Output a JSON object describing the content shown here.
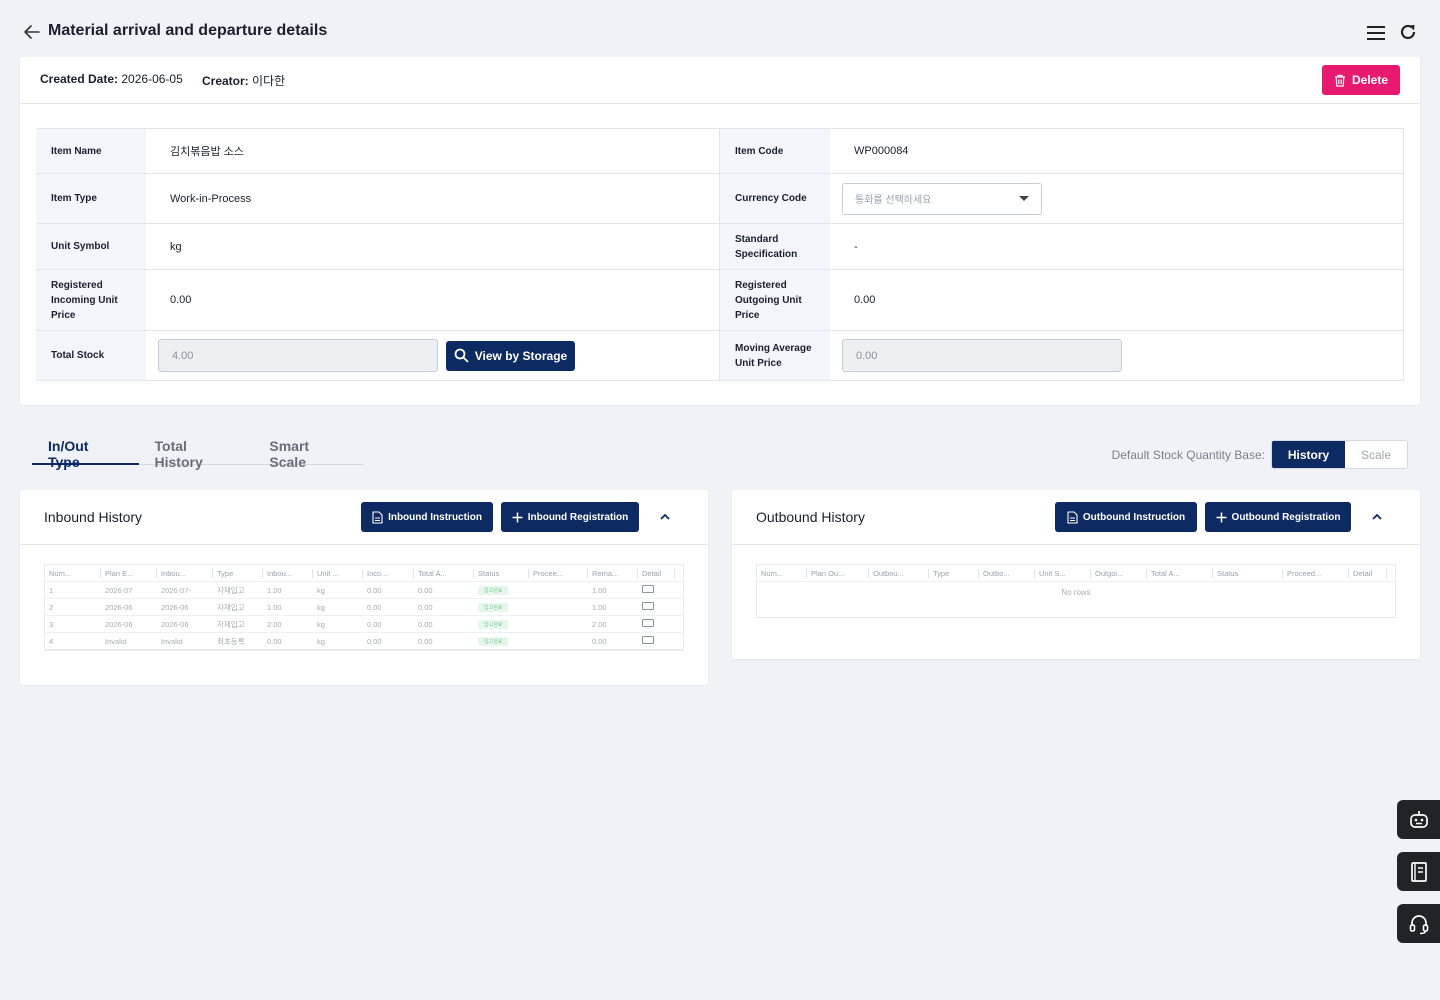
{
  "header": {
    "title": "Material arrival and departure details"
  },
  "meta": {
    "created_label": "Created Date:",
    "created_value": "2026-06-05",
    "creator_label": "Creator:",
    "creator_value": "이다한",
    "delete_label": "Delete"
  },
  "fields": {
    "item_name_label": "Item Name",
    "item_name": "김치볶음밥 소스",
    "item_code_label": "Item Code",
    "item_code": "WP000084",
    "item_type_label": "Item Type",
    "item_type": "Work-in-Process",
    "currency_label": "Currency Code",
    "currency_placeholder": "통화를 선택하세요",
    "unit_label": "Unit Symbol",
    "unit": "kg",
    "standard_label": "Standard Specification",
    "standard": "-",
    "in_price_label": "Registered Incoming Unit Price",
    "in_price": "0.00",
    "out_price_label": "Registered Outgoing Unit Price",
    "out_price": "0.00",
    "total_stock_label": "Total Stock",
    "total_stock": "4.00",
    "view_storage_label": "View by Storage",
    "moving_avg_label": "Moving Average Unit Price",
    "moving_avg": "0.00"
  },
  "tabs": [
    "In/Out Type",
    "Total History",
    "Smart Scale"
  ],
  "stock_base": {
    "label": "Default Stock Quantity Base:",
    "options": [
      "History",
      "Scale"
    ],
    "selected": "History"
  },
  "inbound": {
    "title": "Inbound History",
    "instruction_label": "Inbound Instruction",
    "registration_label": "Inbound Registration",
    "columns": [
      "Num...",
      "Plan E...",
      "Inbou...",
      "Type",
      "Inbou...",
      "Unit ...",
      "Inco...",
      "Total A...",
      "Status",
      "Procee...",
      "Rema...",
      "Detail"
    ],
    "rows": [
      [
        "1",
        "2026-07",
        "2026-07-",
        "자재입고",
        "1.00",
        "kg",
        "0.00",
        "0.00",
        "입고완료",
        "",
        "1.00",
        ""
      ],
      [
        "2",
        "2026-06",
        "2026-06",
        "자재입고",
        "1.00",
        "kg",
        "0.00",
        "0.00",
        "입고완료",
        "",
        "1.00",
        ""
      ],
      [
        "3",
        "2026-06",
        "2026-06",
        "자재입고",
        "2.00",
        "kg",
        "0.00",
        "0.00",
        "입고완료",
        "",
        "2.00",
        ""
      ],
      [
        "4",
        "Invalid",
        "Invalid",
        "최초등록",
        "0.00",
        "kg",
        "0.00",
        "0.00",
        "입고완료",
        "",
        "0.00",
        ""
      ]
    ]
  },
  "outbound": {
    "title": "Outbound History",
    "instruction_label": "Outbound Instruction",
    "registration_label": "Outbound Registration",
    "columns": [
      "Num...",
      "Plan Ou...",
      "Outbou...",
      "Type",
      "Outbo...",
      "Unit S...",
      "Outgoi...",
      "Total A...",
      "Status",
      "Proceed...",
      "Detail"
    ],
    "empty_text": "No rows"
  },
  "colors": {
    "primary": "#0e2a63",
    "danger": "#e8196e",
    "background": "#f0f2f8"
  }
}
